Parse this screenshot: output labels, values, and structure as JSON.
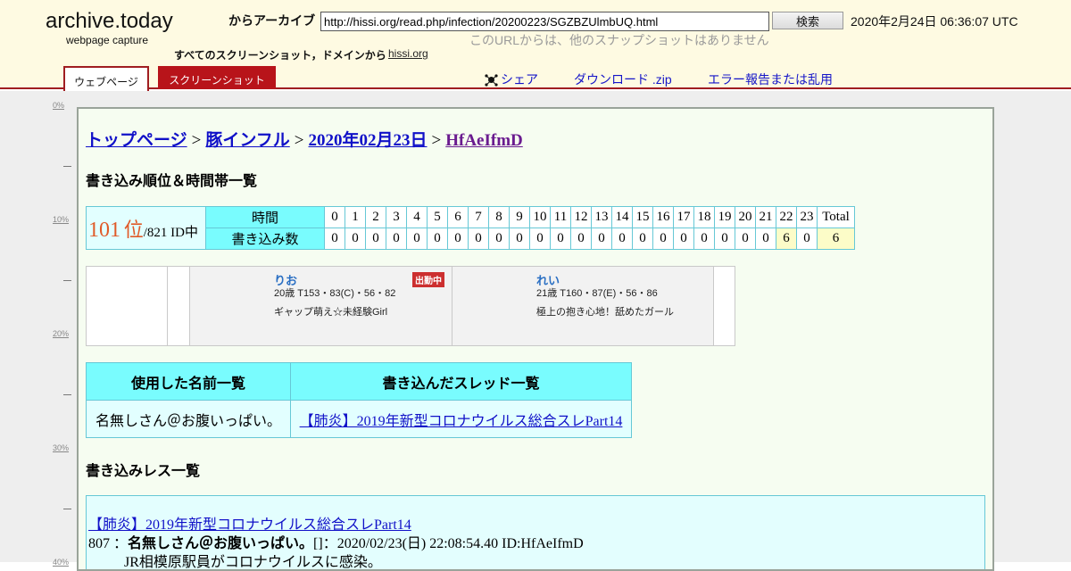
{
  "header": {
    "logo": "archive.today",
    "logo_sub": "webpage capture",
    "from_label": "からアーカイブ",
    "url_value": "http://hissi.org/read.php/infection/20200223/SGZBZUlmbUQ.html",
    "search_label": "検索",
    "capture_date": "2020年2月24日 06:36:07 UTC",
    "no_other": "このURLからは、他のスナップショットはありません",
    "all_shots": "すべてのスクリーンショット，ドメインから",
    "domain": "hissi.org",
    "tab_webpage": "ウェブページ",
    "tab_screenshot": "スクリーンショット",
    "share": "シェア",
    "download": "ダウンロード .zip",
    "report": "エラー報告または乱用",
    "accent_color": "#a01d21",
    "header_bg": "#fefae2"
  },
  "ruler": [
    "0%",
    "10%",
    "20%",
    "30%",
    "40%"
  ],
  "page": {
    "breadcrumb": {
      "top": "トップページ",
      "board": "豚インフル",
      "date": "2020年02月23日",
      "id": "HfAeIfmD",
      "sep": ">"
    },
    "ranking_heading": "書き込み順位＆時間帯一覧",
    "stats": {
      "rank_num": "101",
      "rank_unit": "位",
      "rank_tail": "/821 ID中",
      "hours_label": "時間",
      "count_label": "書き込み数",
      "total_label": "Total",
      "hours": [
        "0",
        "1",
        "2",
        "3",
        "4",
        "5",
        "6",
        "7",
        "8",
        "9",
        "10",
        "11",
        "12",
        "13",
        "14",
        "15",
        "16",
        "17",
        "18",
        "19",
        "20",
        "21",
        "22",
        "23"
      ],
      "counts": [
        "0",
        "0",
        "0",
        "0",
        "0",
        "0",
        "0",
        "0",
        "0",
        "0",
        "0",
        "0",
        "0",
        "0",
        "0",
        "0",
        "0",
        "0",
        "0",
        "0",
        "0",
        "0",
        "6",
        "0"
      ],
      "total": "6"
    },
    "ads": [
      {
        "name": "りお",
        "spec": "20歳 T153・83(C)・56・82",
        "desc": "ギャップ萌え☆未経験Girl",
        "badge": "出勤中"
      },
      {
        "name": "れい",
        "spec": "21歳 T160・87(E)・56・86",
        "desc": "極上の抱き心地！舐めたガール",
        "badge": ""
      }
    ],
    "names_header": "使用した名前一覧",
    "threads_header": "書き込んだスレッド一覧",
    "name_value": "名無しさん＠お腹いっぱい。",
    "thread_value": "【肺炎】2019年新型コロナウイルス総合スレPart14",
    "posts_heading": "書き込みレス一覧",
    "post": {
      "thread": "【肺炎】2019年新型コロナウイルス総合スレPart14",
      "number": "807",
      "name": "名無しさん＠お腹いっぱい。",
      "mail": "[]",
      "datetime": "：2020/02/23(日) 22:08:54.40 ID:HfAeIfmD",
      "body": "JR相模原駅員がコロナウイルスに感染。"
    }
  }
}
